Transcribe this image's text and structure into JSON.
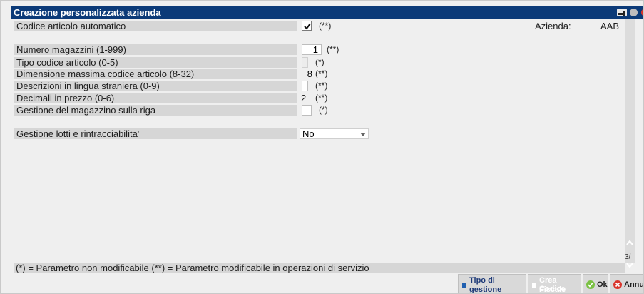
{
  "window": {
    "title": "Creazione personalizzata azienda"
  },
  "header": {
    "auto_code_label": "Codice articolo automatico",
    "auto_code_checked": true,
    "auto_code_note": "(**)",
    "azienda_label": "Azienda:",
    "azienda_value": "AAB"
  },
  "fields": [
    {
      "label": "Numero magazzini (1-999)",
      "value": "1",
      "note": "(**)"
    },
    {
      "label": "Tipo codice articolo (0-5)",
      "value": "",
      "note": "(*)"
    },
    {
      "label": "Dimensione massima codice articolo (8-32)",
      "value": "8",
      "note": "(**)"
    },
    {
      "label": "Descrizioni in lingua straniera (0-9)",
      "value": "",
      "note": "(**)"
    },
    {
      "label": "Decimali in prezzo (0-6)",
      "value": "2",
      "note": "(**)"
    },
    {
      "label": "Gestione del magazzino sulla riga",
      "value": "",
      "note": "(*)"
    }
  ],
  "lotti": {
    "label": "Gestione lotti e rintracciabilita'",
    "selected": "No"
  },
  "scroll": {
    "page_indicator": "3/"
  },
  "footer_text": "(*) = Parametro non modificabile   (**) = Parametro modificabile in operazioni di servizio",
  "buttons": {
    "tipo_line1": "Tipo di",
    "tipo_line2": "gestione archivi",
    "crea_line1": "Crea Codice",
    "crea_line2": "Fiscale",
    "ok": "Ok",
    "annulla": "Annul"
  },
  "colors": {
    "titlebar": "#0b3a78",
    "accent_blue": "#1f5fb0",
    "ok_green": "#7ac143",
    "cancel_red": "#d9342b"
  }
}
